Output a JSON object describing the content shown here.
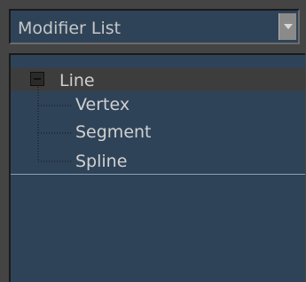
{
  "modifier_dropdown": {
    "label": "Modifier List",
    "arrow_icon": "dropdown-arrow-icon"
  },
  "stack": {
    "root": {
      "label": "Line",
      "expanded": true,
      "toggle_icon": "minus-box-icon"
    },
    "sub_objects": [
      {
        "label": "Vertex"
      },
      {
        "label": "Segment"
      },
      {
        "label": "Spline"
      }
    ]
  },
  "colors": {
    "panel_background": "#444444",
    "list_background": "#2f4358",
    "text": "#cfcfcf",
    "selected_row": "#3d3d3d"
  }
}
